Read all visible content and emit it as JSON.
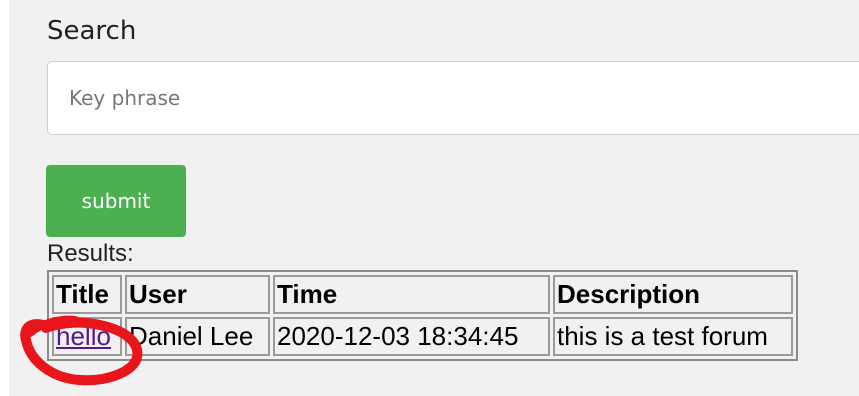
{
  "search": {
    "label": "Search",
    "placeholder": "Key phrase",
    "value": ""
  },
  "submit": {
    "label": "submit"
  },
  "results": {
    "label": "Results:",
    "columns": [
      "Title",
      "User",
      "Time",
      "Description"
    ],
    "rows": [
      {
        "title": "hello",
        "user": "Daniel Lee",
        "time": "2020-12-03 18:34:45",
        "description": "this is a test forum"
      }
    ]
  },
  "colors": {
    "submit_bg": "#4caf50",
    "link": "#551a8b",
    "annotation": "#e8151b"
  }
}
